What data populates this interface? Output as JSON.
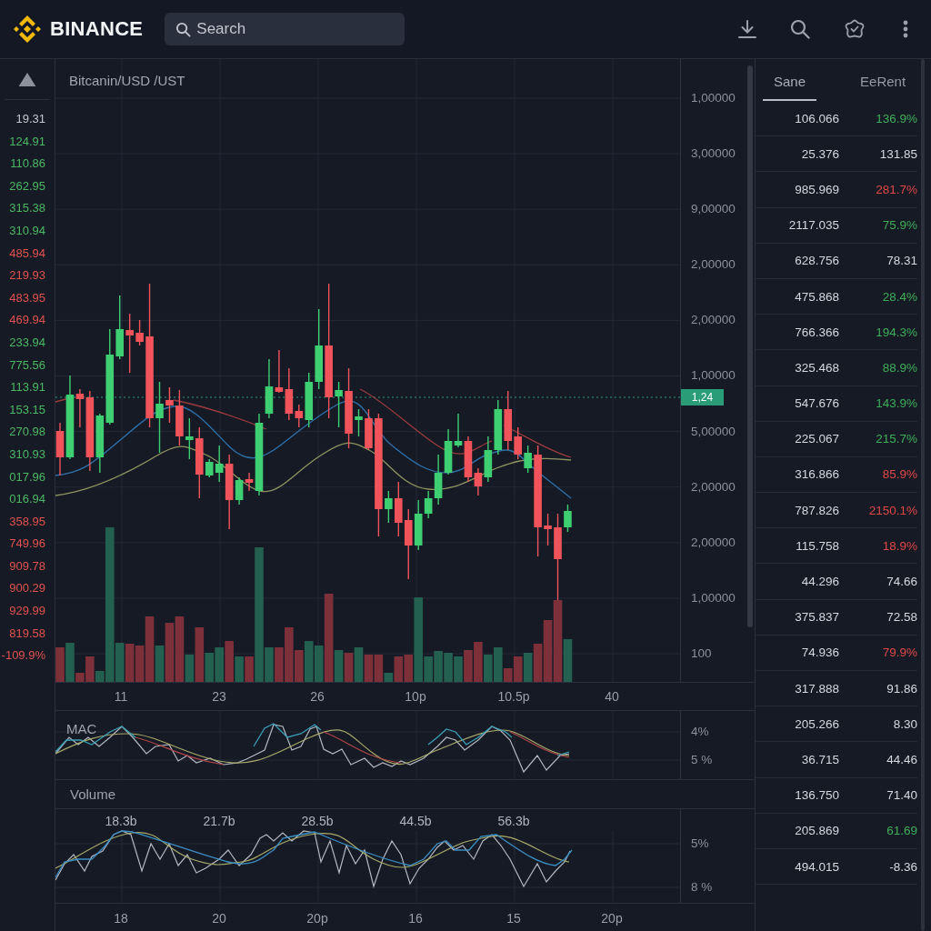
{
  "top_bar": {
    "brand": "BINANCE",
    "search": {
      "placeholder": "Search"
    }
  },
  "price_scale": {
    "labels": [
      {
        "text": "19.31",
        "color": "#c4c7cf"
      },
      {
        "text": "124.91",
        "color": "#4cb865"
      },
      {
        "text": "110.86",
        "color": "#4cb865"
      },
      {
        "text": "262.95",
        "color": "#4cb865"
      },
      {
        "text": "315.38",
        "color": "#4cb865"
      },
      {
        "text": "310.94",
        "color": "#4cb865"
      },
      {
        "text": "485.94",
        "color": "#e0524f"
      },
      {
        "text": "219.93",
        "color": "#e0524f"
      },
      {
        "text": "483.95",
        "color": "#e0524f"
      },
      {
        "text": "469.94",
        "color": "#e0524f"
      },
      {
        "text": "233.94",
        "color": "#4cb865"
      },
      {
        "text": "775.56",
        "color": "#4cb865"
      },
      {
        "text": "113.91",
        "color": "#4cb865"
      },
      {
        "text": "153.15",
        "color": "#4cb865"
      },
      {
        "text": "270.98",
        "color": "#4cb865"
      },
      {
        "text": "310.93",
        "color": "#4cb865"
      },
      {
        "text": "017.96",
        "color": "#4cb865"
      },
      {
        "text": "016.94",
        "color": "#4cb865"
      },
      {
        "text": "358.95",
        "color": "#e0524f"
      },
      {
        "text": "749.96",
        "color": "#e0524f"
      },
      {
        "text": "909.78",
        "color": "#e0524f"
      },
      {
        "text": "900.29",
        "color": "#e0524f"
      },
      {
        "text": "929.99",
        "color": "#e0524f"
      },
      {
        "text": "819.58",
        "color": "#e0524f"
      },
      {
        "text": "-109.9%",
        "color": "#e0524f"
      }
    ]
  },
  "chart": {
    "title": "Bitcanin/USD /UST",
    "y_axis": [
      "1,00000",
      "3,00000",
      "9,00000",
      "2,00000",
      "2,00000",
      "1,00000",
      "5,00000",
      "2,00000",
      "2,00000",
      "1,00000",
      "100"
    ],
    "price_tag": "1,24",
    "x_axis": [
      "11",
      "23",
      "26",
      "10p",
      "10.5p",
      "40"
    ]
  },
  "mac_panel": {
    "label": "MAC",
    "y_axis": [
      "4%",
      "5 %"
    ]
  },
  "volume_panel": {
    "label": "Volume",
    "markers": [
      "18.3b",
      "21.7b",
      "28.5b",
      "44.5b",
      "56.3b"
    ],
    "y_axis": [
      "5%",
      "8 %"
    ],
    "x_axis": [
      "18",
      "20",
      "20p",
      "16",
      "15",
      "20p"
    ]
  },
  "market_list": {
    "tabs": [
      {
        "label": "Sane",
        "selected": true
      },
      {
        "label": "EeRent",
        "selected": false
      }
    ],
    "rows": [
      {
        "value": "106.066",
        "change": "136.9%",
        "color": "#3fae5a"
      },
      {
        "value": "25.376",
        "change": "131.85",
        "color": "#d6d8de"
      },
      {
        "value": "985.969",
        "change": "281.7%",
        "color": "#e04848"
      },
      {
        "value": "2117.035",
        "change": "75.9%",
        "color": "#3fae5a"
      },
      {
        "value": "628.756",
        "change": "78.31",
        "color": "#d6d8de"
      },
      {
        "value": "475.868",
        "change": "28.4%",
        "color": "#3fae5a"
      },
      {
        "value": "766.366",
        "change": "194.3%",
        "color": "#3fae5a"
      },
      {
        "value": "325.468",
        "change": "88.9%",
        "color": "#3fae5a"
      },
      {
        "value": "547.676",
        "change": "143.9%",
        "color": "#3fae5a"
      },
      {
        "value": "225.067",
        "change": "215.7%",
        "color": "#3fae5a"
      },
      {
        "value": "316.866",
        "change": "85.9%",
        "color": "#e04848"
      },
      {
        "value": "787.826",
        "change": "2150.1%",
        "color": "#e04848"
      },
      {
        "value": "115.758",
        "change": "18.9%",
        "color": "#e04848"
      },
      {
        "value": "44.296",
        "change": "74.66",
        "color": "#d6d8de"
      },
      {
        "value": "375.837",
        "change": "72.58",
        "color": "#d6d8de"
      },
      {
        "value": "74.936",
        "change": "79.9%",
        "color": "#e04848"
      },
      {
        "value": "317.888",
        "change": "91.86",
        "color": "#d6d8de"
      },
      {
        "value": "205.266",
        "change": "8.30",
        "color": "#d6d8de"
      },
      {
        "value": "36.715",
        "change": "44.46",
        "color": "#d6d8de"
      },
      {
        "value": "136.750",
        "change": "71.40",
        "color": "#d6d8de"
      },
      {
        "value": "205.869",
        "change": "61.69",
        "color": "#3fae5a"
      },
      {
        "value": "494.015",
        "change": "-8.36",
        "color": "#d6d8de"
      }
    ]
  }
}
